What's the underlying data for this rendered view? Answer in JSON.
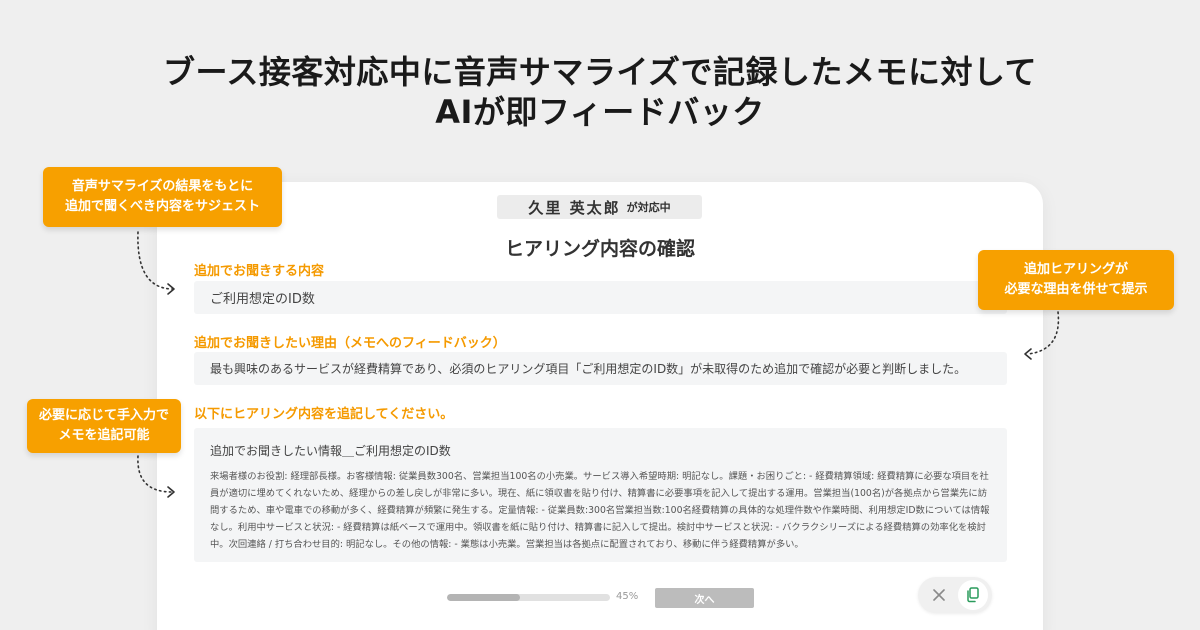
{
  "headline": {
    "line1": "ブース接客対応中に音声サマライズで記録したメモに対して",
    "line2": "AIが即フィードバック"
  },
  "status": {
    "name": "久里 英太郎",
    "suffix": "が対応中"
  },
  "card_title": "ヒアリング内容の確認",
  "sections": {
    "ask_label": "追加でお聞きする内容",
    "ask_value": "ご利用想定のID数",
    "reason_label": "追加でお聞きしたい理由（メモへのフィードバック）",
    "reason_value": "最も興味のあるサービスが経費精算であり、必須のヒアリング項目「ご利用想定のID数」が未取得のため追加で確認が必要と判断しました。",
    "append_label": "以下にヒアリング内容を追記してください。"
  },
  "memo": {
    "heading": "追加でお聞きしたい情報＿ご利用想定のID数",
    "body": "来場者様のお役割: 経理部長様。お客様情報: 従業員数300名、営業担当100名の小売業。サービス導入希望時期: 明記なし。課題・お困りごと: - 経費精算領域: 経費精算に必要な項目を社員が適切に埋めてくれないため、経理からの差し戻しが非常に多い。現在、紙に領収書を貼り付け、精算書に必要事項を記入して提出する運用。営業担当(100名)が各拠点から営業先に訪問するため、車や電車での移動が多く、経費精算が頻繁に発生する。定量情報: - 従業員数:300名営業担当数:100名経費精算の具体的な処理件数や作業時間、利用想定ID数については情報なし。利用中サービスと状況: - 経費精算は紙ベースで運用中。領収書を紙に貼り付け、精算書に記入して提出。検討中サービスと状況: - バクラクシリーズによる経費精算の効率化を検討中。次回連絡 / 打ち合わせ目的: 明記なし。その他の情報: - 業態は小売業。営業担当は各拠点に配置されており、移動に伴う経費精算が多い。"
  },
  "callouts": {
    "suggest": [
      "音声サマライズの結果をもとに",
      "追加で聞くべき内容をサジェスト"
    ],
    "reason": [
      "追加ヒアリングが",
      "必要な理由を併せて提示"
    ],
    "manual": [
      "必要に応じて手入力で",
      "メモを追記可能"
    ]
  },
  "progress": {
    "percent": 45,
    "label": "45%"
  },
  "next_button_label": "次へ",
  "icons": {
    "close": "close-icon",
    "copy": "copy-icon"
  },
  "colors": {
    "accent": "#f7a000",
    "label": "#f59a00",
    "background": "#efefef"
  }
}
